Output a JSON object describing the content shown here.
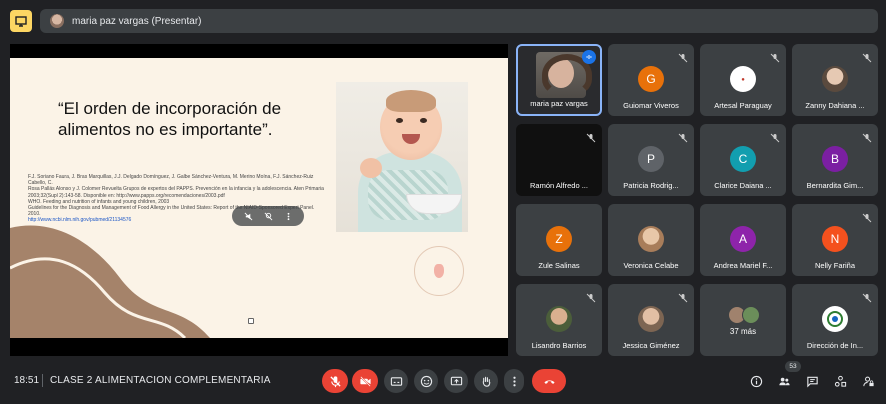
{
  "topbar": {
    "presenter_label": "maria paz vargas (Presentar)"
  },
  "slide": {
    "title": "“El orden de incorporación de alimentos no es importante”.",
    "references": [
      "F.J. Soriano Faura, J. Bras Marquillas, J.J. Delgado Domínguez, J. Galbe Sánchez-Ventura, M. Merino Moína, F.J. Sánchez-Ruiz Cabello, C.",
      "Rosa Pallás Alonso y J. Colomer Revuelta Grupos de expertos del PAPPS. Prevención en la infancia y la adolescencia. Aten Primaria",
      "2003;32(Supl 2):143-58. Disponible en: http://www.papps.org/recomendaciones/2003.pdf",
      "WHO. Feeding and nutrition of infants and young children, 2003",
      "Guidelines for the Diagnosis and Management of Food Allergy in the United States: Report of the NIAID-Sponsored Expert Panel. 2010."
    ],
    "reference_link": "http://www.ncbi.nlm.nih.gov/pubmed/21134576"
  },
  "participants": [
    {
      "name": "maria paz vargas",
      "type": "video"
    },
    {
      "name": "Guiomar Viveros",
      "initial": "G",
      "color": "#e8710a"
    },
    {
      "name": "Artesal Paraguay",
      "initial": "",
      "color": "#ffffff"
    },
    {
      "name": "Zanny Dahiana ...",
      "initial": "",
      "color": "#c9b8a8"
    },
    {
      "name": "Ramón Alfredo ...",
      "type": "black"
    },
    {
      "name": "Patricia Rodrig...",
      "initial": "P",
      "color": "#5f6368"
    },
    {
      "name": "Clarice Daiana ...",
      "initial": "C",
      "color": "#129eaf"
    },
    {
      "name": "Bernardita Gim...",
      "initial": "B",
      "color": "#7b1fa2"
    },
    {
      "name": "Zule Salinas",
      "initial": "Z",
      "color": "#e8710a"
    },
    {
      "name": "Veronica Celabe",
      "initial": "",
      "color": "#e6d4c4"
    },
    {
      "name": "Andrea Mariel F...",
      "initial": "A",
      "color": "#8e24aa"
    },
    {
      "name": "Nelly Fariña",
      "initial": "N",
      "color": "#f4511e"
    },
    {
      "name": "Lisandro Barrios",
      "initial": "",
      "color": "#7a8a6a"
    },
    {
      "name": "Jessica Giménez",
      "initial": "",
      "color": "#b6a08c"
    },
    {
      "name": "37 más",
      "type": "more"
    },
    {
      "name": "Dirección de In...",
      "initial": "",
      "color": "#ffffff"
    }
  ],
  "bottombar": {
    "time": "18:51",
    "meeting_title": "CLASE 2 ALIMENTACION COMPLEMENTARIA",
    "people_count": "53"
  },
  "colors": {
    "end_call": "#ea4335",
    "accent": "#8ab4f8",
    "present_icon": "#fdd663"
  }
}
